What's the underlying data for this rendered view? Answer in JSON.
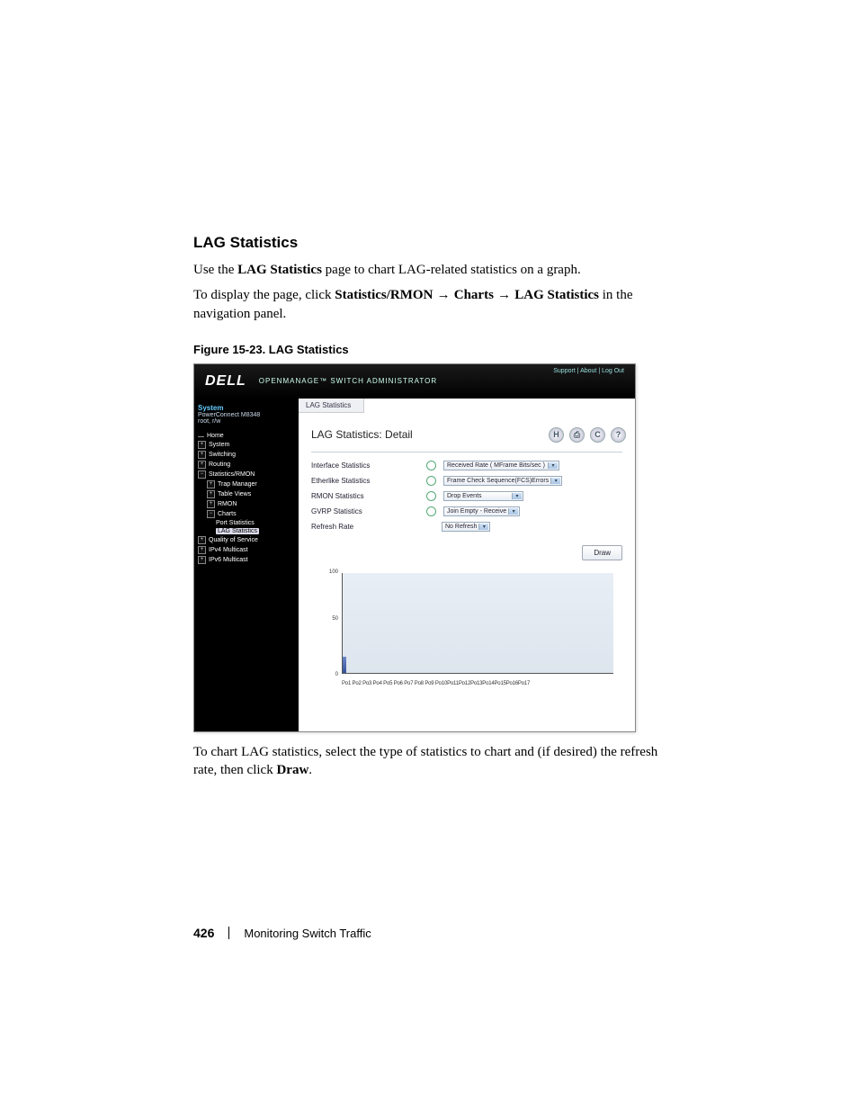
{
  "doc": {
    "section_title": "LAG Statistics",
    "p1_a": "Use the ",
    "p1_b": "LAG Statistics",
    "p1_c": " page to chart LAG-related statistics on a graph.",
    "p2_a": "To display the page, click ",
    "p2_b": "Statistics/RMON",
    "p2_c": "Charts",
    "p2_d": "LAG Statistics",
    "p2_e": " in the navigation panel.",
    "arrow": " → ",
    "figcap": "Figure 15-23.    LAG Statistics",
    "p3_a": "To chart LAG statistics, select the type of statistics to chart and (if desired) the refresh rate, then click ",
    "p3_b": "Draw",
    "p3_c": "."
  },
  "footer": {
    "page": "426",
    "chapter": "Monitoring Switch Traffic"
  },
  "shot": {
    "brand": "DELL",
    "subtitle": "OPENMANAGE™ SWITCH ADMINISTRATOR",
    "toplinks": "Support  |  About  |  Log Out",
    "sys_title": "System",
    "sys_sub1": "PowerConnect M8348",
    "sys_sub2": "root, r/w",
    "tree": {
      "home": "Home",
      "system": "System",
      "switching": "Switching",
      "routing": "Routing",
      "stats": "Statistics/RMON",
      "trap": "Trap Manager",
      "table": "Table Views",
      "rmon": "RMON",
      "charts": "Charts",
      "port": "Port Statistics",
      "lag": "LAG  Statistics",
      "qos": "Quality of Service",
      "ipv4": "IPv4 Multicast",
      "ipv6": "IPv6 Multicast"
    },
    "tab": "LAG Statistics",
    "detail_title": "LAG Statistics: Detail",
    "icons": {
      "h": "H",
      "print": "⎙",
      "c": "C",
      "q": "?"
    },
    "opts": {
      "if_label": "Interface Statistics",
      "if_value": "Received Rate ( MFrame Bits/sec )",
      "eth_label": "Etherlike Statistics",
      "eth_value": "Frame Check Sequence(FCS)Errors",
      "rmon_label": "RMON Statistics",
      "rmon_value": "Drop Events",
      "gvrp_label": "GVRP Statistics",
      "gvrp_value": "Join Empty - Receive",
      "refresh_label": "Refresh Rate",
      "refresh_value": "No Refresh"
    },
    "draw": "Draw",
    "chart": {
      "y100": "100",
      "y50": "50",
      "y0": "0",
      "xlabels": "Po1 Po2 Po3 Po4 Po5 Po6 Po7 Po8 Po9 Po10Po11Po12Po13Po14Po15Po16Po17"
    }
  },
  "chart_data": {
    "type": "bar",
    "title": "LAG Statistics",
    "ylabel": "",
    "xlabel": "",
    "ylim": [
      0,
      100
    ],
    "categories": [
      "Po1",
      "Po2",
      "Po3",
      "Po4",
      "Po5",
      "Po6",
      "Po7",
      "Po8",
      "Po9",
      "Po10",
      "Po11",
      "Po12",
      "Po13",
      "Po14",
      "Po15",
      "Po16",
      "Po17"
    ],
    "values": [
      15,
      0,
      0,
      0,
      0,
      0,
      0,
      0,
      0,
      0,
      0,
      0,
      0,
      0,
      0,
      0,
      0
    ]
  }
}
